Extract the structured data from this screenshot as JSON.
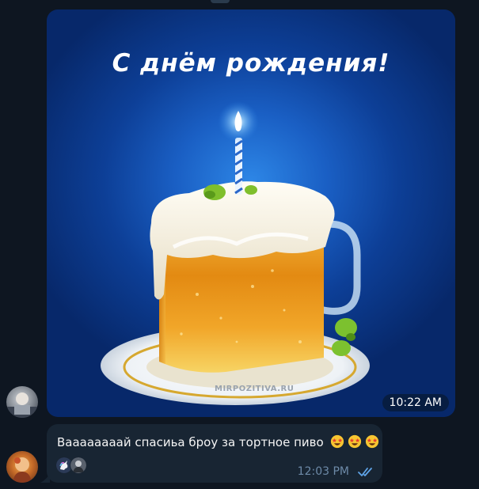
{
  "photo_message": {
    "title": "С днём рождения!",
    "watermark": "MIRPOZITIVA.RU",
    "time": "10:22 AM"
  },
  "text_message": {
    "text": "Ваааааааай спасиьа броу за тортное пиво",
    "emoji": [
      "star-struck",
      "star-struck",
      "star-struck"
    ],
    "time": "12:03 PM",
    "status": "read"
  },
  "reactions": [
    "unicorn-avatar",
    "user-avatar"
  ],
  "colors": {
    "background": "#0e1621",
    "bubble": "#182533",
    "time_text": "#6d8aa8",
    "check": "#5fa4e8"
  }
}
